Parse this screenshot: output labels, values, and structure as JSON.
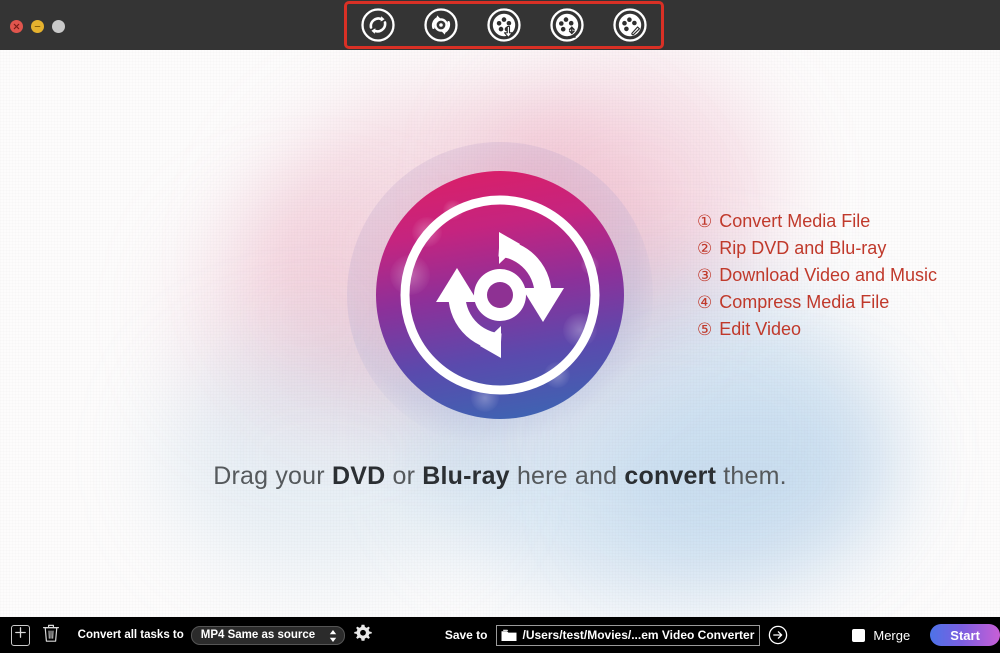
{
  "window": {
    "controls": [
      {
        "name": "close",
        "color": "#e0554d"
      },
      {
        "name": "minimize",
        "color": "#e5b22e"
      },
      {
        "name": "zoom",
        "color": "#c9c9c9"
      }
    ],
    "titlebar_color": "#343434"
  },
  "toolbar": {
    "highlight_color": "#d93025",
    "buttons": [
      {
        "id": 1,
        "icon": "convert-media-icon",
        "label": "Convert Media File",
        "marker": "①"
      },
      {
        "id": 2,
        "icon": "rip-disc-icon",
        "label": "Rip DVD and Blu-ray",
        "marker": "②"
      },
      {
        "id": 3,
        "icon": "download-reel-icon",
        "label": "Download Video and Music",
        "marker": "③"
      },
      {
        "id": 4,
        "icon": "compress-reel-icon",
        "label": "Compress Media File",
        "marker": "④"
      },
      {
        "id": 5,
        "icon": "edit-reel-icon",
        "label": "Edit Video",
        "marker": "⑤"
      }
    ],
    "markers": [
      "①",
      "②",
      "③",
      "④",
      "⑤"
    ]
  },
  "legend": {
    "color": "#c0392b",
    "items": [
      {
        "marker": "①",
        "text": "Convert Media File"
      },
      {
        "marker": "②",
        "text": "Rip DVD and Blu-ray"
      },
      {
        "marker": "③",
        "text": "Download Video and Music"
      },
      {
        "marker": "④",
        "text": "Compress Media File"
      },
      {
        "marker": "⑤",
        "text": "Edit Video"
      }
    ]
  },
  "main": {
    "logo_name": "convert-cycle-logo",
    "logo_gradient": [
      "#d8206a",
      "#9b2f93",
      "#3f63b2"
    ],
    "drop_hint": {
      "part1": "Drag your ",
      "bold1": "DVD",
      "part2": " or ",
      "bold2": "Blu-ray",
      "part3": " here and ",
      "bold3": "convert",
      "part4": " them."
    }
  },
  "bottombar": {
    "add_label": "+",
    "convert_all_label": "Convert all tasks to",
    "format_value": "MP4 Same as source",
    "save_to_label": "Save to",
    "save_path": "/Users/test/Movies/...em Video Converter",
    "merge_label": "Merge",
    "merge_checked": false,
    "start_label": "Start",
    "start_gradient": [
      "#4d73e8",
      "#c85fd6"
    ]
  }
}
